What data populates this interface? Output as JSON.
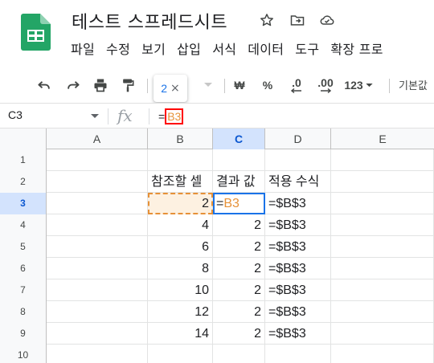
{
  "doc": {
    "title": "테스트 스프레드시트"
  },
  "menu": [
    "파일",
    "수정",
    "보기",
    "삽입",
    "서식",
    "데이터",
    "도구",
    "확장 프로"
  ],
  "toolbar": {
    "zoom_popup_value": "2",
    "zoom_popup_close": "×",
    "currency": "₩",
    "percent": "%",
    "dec_decrease": ".0",
    "dec_increase": ".00",
    "number_format": "123",
    "font": "기본값"
  },
  "formula_bar": {
    "name_box": "C3",
    "fx": "fx",
    "formula_eq": "=",
    "formula_ref": "B3"
  },
  "grid": {
    "columns": [
      "A",
      "B",
      "C",
      "D",
      "E"
    ],
    "active_column": "C",
    "active_row": "3",
    "rows": [
      {
        "n": "1",
        "a": "",
        "b": "",
        "c": "",
        "d": ""
      },
      {
        "n": "2",
        "a": "",
        "b": "참조할 셀",
        "c": "결과 값",
        "d": "적용 수식"
      },
      {
        "n": "3",
        "a": "",
        "b": "2",
        "c": "",
        "d": "=$B$3"
      },
      {
        "n": "4",
        "a": "",
        "b": "4",
        "c": "2",
        "d": "=$B$3"
      },
      {
        "n": "5",
        "a": "",
        "b": "6",
        "c": "2",
        "d": "=$B$3"
      },
      {
        "n": "6",
        "a": "",
        "b": "8",
        "c": "2",
        "d": "=$B$3"
      },
      {
        "n": "7",
        "a": "",
        "b": "10",
        "c": "2",
        "d": "=$B$3"
      },
      {
        "n": "8",
        "a": "",
        "b": "12",
        "c": "2",
        "d": "=$B$3"
      },
      {
        "n": "9",
        "a": "",
        "b": "14",
        "c": "2",
        "d": "=$B$3"
      },
      {
        "n": "10",
        "a": "",
        "b": "",
        "c": "",
        "d": ""
      }
    ],
    "editing_cell": {
      "eq": "=",
      "ref": "B3"
    }
  },
  "colors": {
    "accent": "#1a73e8",
    "reference": "#e69138",
    "sheets_green": "#0f9d58"
  }
}
